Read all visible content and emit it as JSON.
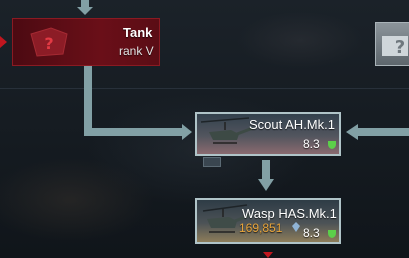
{
  "tree": {
    "tank": {
      "name": "Tank",
      "rank": "rank V"
    },
    "scout": {
      "name": "Scout AH.Mk.1",
      "br": "8.3"
    },
    "wasp": {
      "name": "Wasp HAS.Mk.1",
      "price": "169,851",
      "br": "8.3"
    }
  },
  "colors": {
    "connector": "#82a0a5",
    "locked_card": "#6a0f18",
    "price": "#e8a43a",
    "br_ok": "#5ccf4a"
  },
  "icons": {
    "tank": "question-mark-shield-icon",
    "right_node": "question-mark-icon",
    "scout": "helicopter-icon",
    "wasp": "helicopter-icon",
    "br": "green-shield-icon",
    "price": "silver-lions-icon"
  }
}
